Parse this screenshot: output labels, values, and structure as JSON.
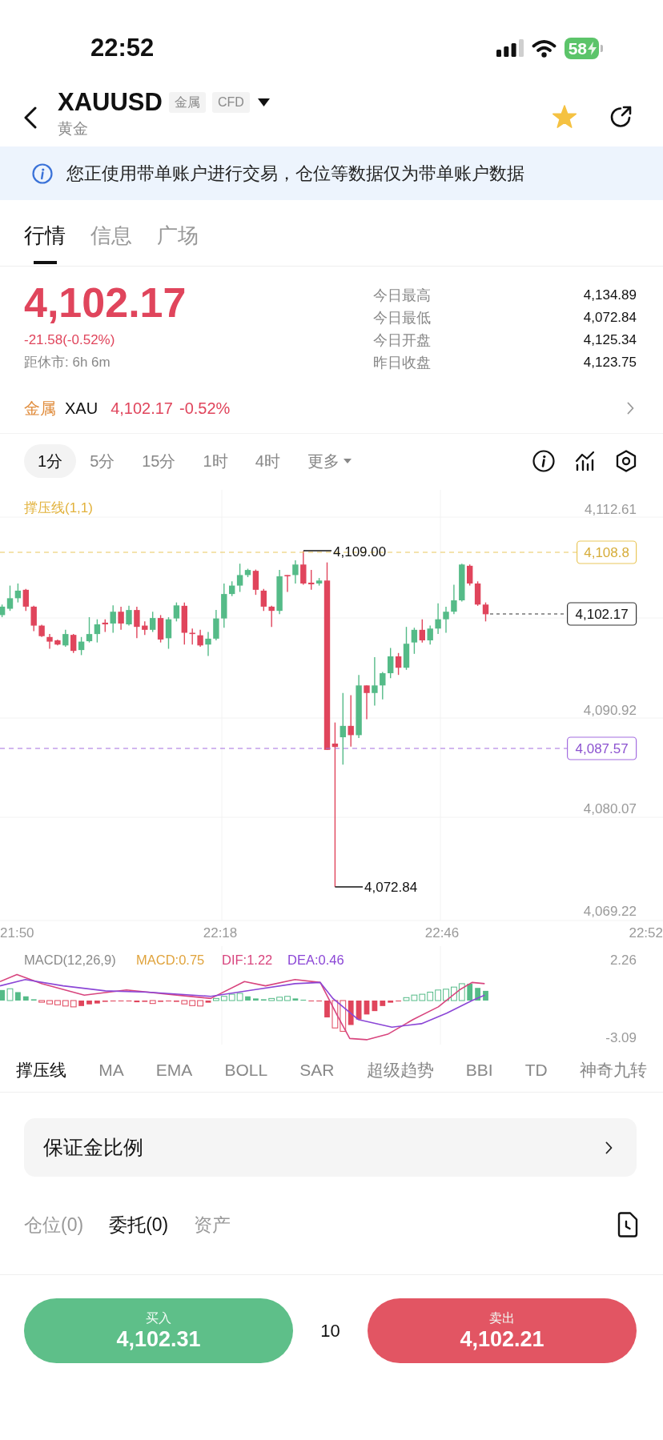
{
  "status_bar": {
    "time": "22:52",
    "battery": "58"
  },
  "header": {
    "symbol": "XAUUSD",
    "tags": [
      "金属",
      "CFD"
    ],
    "subtitle": "黄金",
    "favorite": true
  },
  "notice": {
    "text": "您正使用带单账户进行交易，仓位等数据仅为带单账户数据"
  },
  "tabs": [
    {
      "label": "行情",
      "selected": true
    },
    {
      "label": "信息",
      "selected": false
    },
    {
      "label": "广场",
      "selected": false
    }
  ],
  "quote": {
    "price": "4,102.17",
    "change": "-21.58(-0.52%)",
    "close_countdown": "距休市: 6h 6m",
    "stats": [
      {
        "label": "今日最高",
        "value": "4,134.89"
      },
      {
        "label": "今日最低",
        "value": "4,072.84"
      },
      {
        "label": "今日开盘",
        "value": "4,125.34"
      },
      {
        "label": "昨日收盘",
        "value": "4,123.75"
      }
    ]
  },
  "related": {
    "category": "金属",
    "symbol": "XAU",
    "price": "4,102.17",
    "change": "-0.52%"
  },
  "timeframes": [
    {
      "label": "1分",
      "selected": true,
      "kind": "interval"
    },
    {
      "label": "5分",
      "selected": false,
      "kind": "interval"
    },
    {
      "label": "15分",
      "selected": false,
      "kind": "interval"
    },
    {
      "label": "1时",
      "selected": false,
      "kind": "interval"
    },
    {
      "label": "4时",
      "selected": false,
      "kind": "interval"
    },
    {
      "label": "更多",
      "selected": false,
      "kind": "menu"
    }
  ],
  "chart": {
    "legend": "撑压线(1,1)",
    "y_ticks": [
      "4,112.61",
      "4,090.92",
      "4,080.07",
      "4,069.22"
    ],
    "x_ticks": [
      "21:50",
      "22:18",
      "22:46",
      "22:52"
    ],
    "high_marker": "4,109.00",
    "low_marker": "4,072.84",
    "resistance": "4,108.8",
    "support": "4,087.57",
    "last_price": "4,102.17"
  },
  "macd": {
    "title": "MACD(12,26,9)",
    "macd": "MACD:0.75",
    "dif": "DIF:1.22",
    "dea": "DEA:0.46",
    "y_ticks": [
      "2.26",
      "-3.09"
    ]
  },
  "indicators": [
    {
      "label": "撑压线",
      "selected": true
    },
    {
      "label": "MA",
      "selected": false
    },
    {
      "label": "EMA",
      "selected": false
    },
    {
      "label": "BOLL",
      "selected": false
    },
    {
      "label": "SAR",
      "selected": false
    },
    {
      "label": "超级趋势",
      "selected": false
    },
    {
      "label": "BBI",
      "selected": false
    },
    {
      "label": "TD",
      "selected": false
    },
    {
      "label": "神奇九转",
      "selected": false
    }
  ],
  "margin_row": {
    "label": "保证金比例"
  },
  "position_tabs": [
    {
      "label": "仓位(0)",
      "selected": false
    },
    {
      "label": "委托(0)",
      "selected": true
    },
    {
      "label": "资产",
      "selected": false
    }
  ],
  "trade": {
    "buy": {
      "label": "买入",
      "price": "4,102.31"
    },
    "quantity": "10",
    "sell": {
      "label": "卖出",
      "price": "4,102.21"
    }
  }
}
